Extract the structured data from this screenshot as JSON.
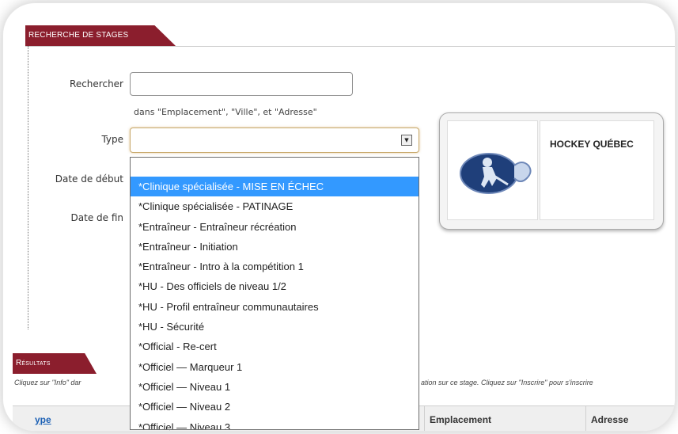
{
  "search_tab": {
    "label": "RECHERCHE DE STAGES"
  },
  "form": {
    "search_label": "Rechercher",
    "search_value": "",
    "search_hint": "dans \"Emplacement\", \"Ville\", et \"Adresse\"",
    "type_label": "Type",
    "type_value": "",
    "start_label": "Date de début",
    "end_label": "Date de fin"
  },
  "type_dropdown": {
    "options": [
      "*Clinique spécialisée - MISE EN ÉCHEC",
      "*Clinique spécialisée - PATINAGE",
      "*Entraîneur - Entraîneur récréation",
      "*Entraîneur - Initiation",
      "*Entraîneur - Intro à la compétition 1",
      "*HU - Des officiels de niveau 1/2",
      "*HU - Profil entraîneur communautaires",
      "*HU - Sécurité",
      "*Official - Re-cert",
      "*Officiel — Marqueur 1",
      "*Officiel — Niveau 1",
      "*Officiel — Niveau 2",
      "*Officiel — Niveau 3"
    ],
    "highlighted_index": 0
  },
  "org_card": {
    "name": "HOCKEY QUÉBEC"
  },
  "results_tab": {
    "label": "Résultats"
  },
  "results": {
    "note_left": "Cliquez sur \"Info\" dar",
    "note_right": "ation sur ce stage. Cliquez sur \"Inscrire\" pour s'inscrire",
    "columns": [
      "ype",
      "Emplacement",
      "Adresse"
    ]
  },
  "colors": {
    "tab_bg": "#8b1e2d",
    "selection": "#3399ff",
    "link": "#1a5fb4"
  }
}
